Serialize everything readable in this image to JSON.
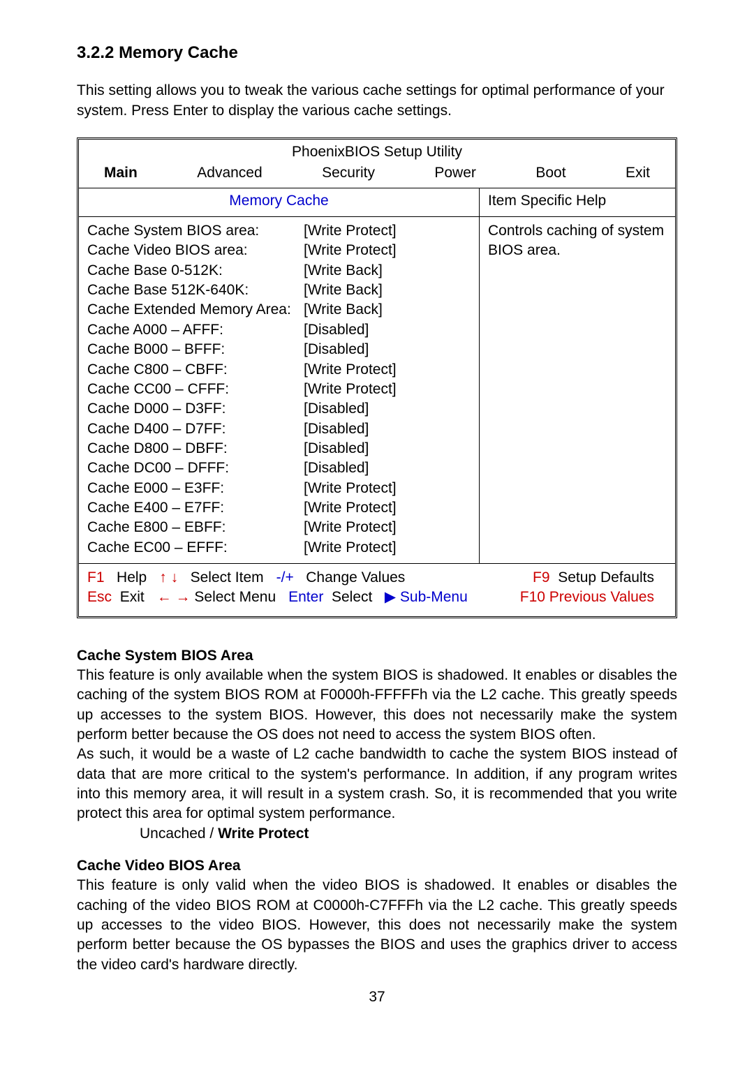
{
  "section": {
    "number": "3.2.2",
    "title": "Memory Cache"
  },
  "intro": "This setting allows you to tweak the various cache settings for optimal performance of your system. Press Enter to display the various cache settings.",
  "bios": {
    "title": "PhoenixBIOS Setup Utility",
    "tabs": {
      "main": "Main",
      "advanced": "Advanced",
      "security": "Security",
      "power": "Power",
      "boot": "Boot",
      "exit": "Exit"
    },
    "screen_title": "Memory Cache",
    "help_header": "Item Specific Help",
    "help_text": "Controls caching of system BIOS area.",
    "settings": [
      {
        "label": "Cache System BIOS area:",
        "value": "[Write Protect]"
      },
      {
        "label": "Cache Video BIOS area:",
        "value": "[Write Protect]"
      },
      {
        "label": "Cache Base 0-512K:",
        "value": "[Write Back]"
      },
      {
        "label": "Cache Base 512K-640K:",
        "value": "[Write Back]"
      },
      {
        "label": "Cache Extended Memory Area:",
        "value": "[Write Back]"
      },
      {
        "label": "Cache A000 – AFFF:",
        "value": "[Disabled]"
      },
      {
        "label": "Cache B000 – BFFF:",
        "value": "[Disabled]"
      },
      {
        "label": "Cache C800 – CBFF:",
        "value": "[Write Protect]"
      },
      {
        "label": "Cache CC00 – CFFF:",
        "value": "[Write Protect]"
      },
      {
        "label": "Cache D000 – D3FF:",
        "value": "[Disabled]"
      },
      {
        "label": "Cache D400 – D7FF:",
        "value": "[Disabled]"
      },
      {
        "label": "Cache D800 – DBFF:",
        "value": "[Disabled]"
      },
      {
        "label": "Cache DC00 – DFFF:",
        "value": "[Disabled]"
      },
      {
        "label": "Cache E000 – E3FF:",
        "value": "[Write Protect]"
      },
      {
        "label": "Cache E400 – E7FF:",
        "value": "[Write Protect]"
      },
      {
        "label": "Cache E800 – EBFF:",
        "value": "[Write Protect]"
      },
      {
        "label": "Cache EC00 – EFFF:",
        "value": "[Write Protect]"
      }
    ],
    "footer": {
      "f1": "F1",
      "help": "Help",
      "updown": "↑ ↓",
      "select_item": "Select Item",
      "plusminus": "-/+",
      "change_values": "Change Values",
      "f9": "F9",
      "setup_defaults": "Setup Defaults",
      "esc": "Esc",
      "exit": "Exit",
      "lr": "← →",
      "select_menu": "Select Menu",
      "enter": "Enter",
      "select": "Select",
      "submenu_arrow": "▶",
      "submenu": "Sub-Menu",
      "f10": "F10",
      "previous_values": "Previous Values"
    }
  },
  "section1": {
    "heading": "Cache System BIOS Area",
    "para1": "This feature is only available when the system BIOS is shadowed. It enables or disables the caching of the system BIOS ROM at F0000h-FFFFFh via the L2 cache. This greatly speeds up accesses to the system BIOS. However, this does not necessarily make the system perform better because the OS does not need to access the system BIOS often.",
    "para2": "As such, it would be a waste of L2 cache bandwidth to cache the system BIOS instead of data that are more critical to the system's performance. In addition, if any program writes into this memory area, it will result in a system crash. So, it is recommended that you write protect this area for optimal system performance.",
    "option_plain": "Uncached / ",
    "option_bold": "Write Protect"
  },
  "section2": {
    "heading": "Cache Video BIOS Area",
    "para": "This feature is only valid when the video BIOS is shadowed. It enables or disables the caching of the video BIOS ROM at C0000h-C7FFFh via the L2 cache. This greatly speeds up accesses to the video BIOS. However, this does not necessarily make the system perform better because the OS bypasses the BIOS and uses the graphics driver to access the video card's hardware directly."
  },
  "page_number": "37"
}
